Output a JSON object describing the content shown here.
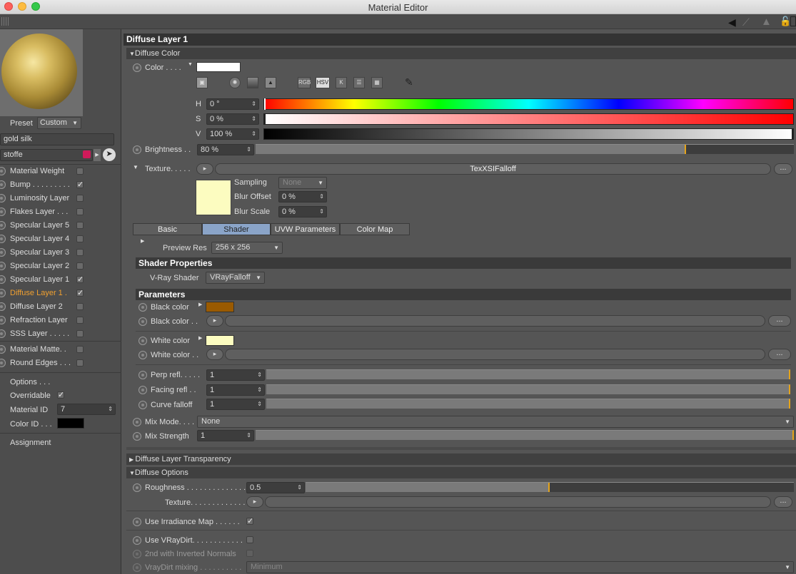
{
  "window": {
    "title": "Material Editor"
  },
  "colors": {
    "accent": "#e5a41a",
    "active_label": "#f0a030",
    "black_color": "#9a5a00",
    "white_color": "#fcfcc0",
    "color_id": "#000000",
    "stoffe_swatch": "#d01a5a"
  },
  "left": {
    "preset_label": "Preset",
    "preset_value": "Custom",
    "material_name": "gold silk",
    "layer_name": "stoffe",
    "channels": [
      {
        "label": "Material Weight",
        "checked": false
      },
      {
        "label": "Bump . . . . . . . . .",
        "checked": true
      },
      {
        "label": "Luminosity Layer",
        "checked": false
      },
      {
        "label": "Flakes Layer . . .",
        "checked": false
      },
      {
        "label": "Specular Layer 5",
        "checked": false
      },
      {
        "label": "Specular Layer 4",
        "checked": false
      },
      {
        "label": "Specular Layer 3",
        "checked": false
      },
      {
        "label": "Specular Layer 2",
        "checked": false
      },
      {
        "label": "Specular Layer 1",
        "checked": true
      },
      {
        "label": "Diffuse Layer 1 .",
        "checked": true,
        "active": true
      },
      {
        "label": "Diffuse Layer 2",
        "checked": false
      },
      {
        "label": "Refraction Layer",
        "checked": false
      },
      {
        "label": "SSS Layer . . . . .",
        "checked": false
      }
    ],
    "channels2": [
      {
        "label": "Material Matte. .",
        "checked": false
      },
      {
        "label": "Round Edges . . .",
        "checked": false
      }
    ],
    "options_label": "Options . . .",
    "overridable_label": "Overridable",
    "material_id_label": "Material ID",
    "material_id_value": "7",
    "color_id_label": "Color ID . . .",
    "assignment_label": "Assignment"
  },
  "main": {
    "header": "Diffuse Layer 1",
    "diffuse_color_section": "Diffuse Color",
    "color_label": "Color . . . .",
    "h_label": "H",
    "h_value": "0 °",
    "s_label": "S",
    "s_value": "0 %",
    "v_label": "V",
    "v_value": "100 %",
    "mode_rgb": "RGB",
    "mode_hsv": "HSV",
    "mode_k": "K",
    "brightness_label": "Brightness . .",
    "brightness_value": "80 %",
    "brightness_fraction": 0.8,
    "texture_label": "Texture. . . . .",
    "texture_name": "TexXSIFalloff",
    "sampling_label": "Sampling",
    "sampling_value": "None",
    "blur_offset_label": "Blur Offset",
    "blur_offset_value": "0 %",
    "blur_scale_label": "Blur Scale",
    "blur_scale_value": "0 %",
    "tabs": [
      "Basic",
      "Shader",
      "UVW Parameters",
      "Color Map"
    ],
    "active_tab": "Shader",
    "preview_res_label": "Preview Res",
    "preview_res_value": "256 x 256",
    "shader_props_header": "Shader Properties",
    "vray_shader_label": "V-Ray Shader",
    "vray_shader_value": "VRayFalloff",
    "parameters_header": "Parameters",
    "black_color_label": "Black color",
    "black_color_label2": "Black color . .",
    "white_color_label": "White color",
    "white_color_label2": "White color . .",
    "perp_label": "Perp refl. . . . .",
    "perp_value": "1",
    "facing_label": "Facing refl . .",
    "facing_value": "1",
    "curve_label": "Curve falloff",
    "curve_value": "1",
    "mix_mode_label": "Mix Mode. . . .",
    "mix_mode_value": "None",
    "mix_strength_label": "Mix Strength",
    "mix_strength_value": "1",
    "diffuse_transparency_section": "Diffuse Layer Transparency",
    "diffuse_options_section": "Diffuse Options",
    "roughness_label": "Roughness . . . . . . . . . . . . . .",
    "roughness_value": "0.5",
    "roughness_fraction": 0.5,
    "texture2_label": "Texture. . . . . . . . . . . . . . . . . .",
    "use_irradiance_label": "Use Irradiance Map . . . . . .",
    "use_vraydirt_label": "Use VRayDirt. . . . . . . . . . . .",
    "inverted_normals_label": "2nd with Inverted Normals",
    "vraydirt_mixing_label": "VrayDirt mixing . . . . . . . . . .",
    "vraydirt_mixing_value": "Minimum"
  }
}
